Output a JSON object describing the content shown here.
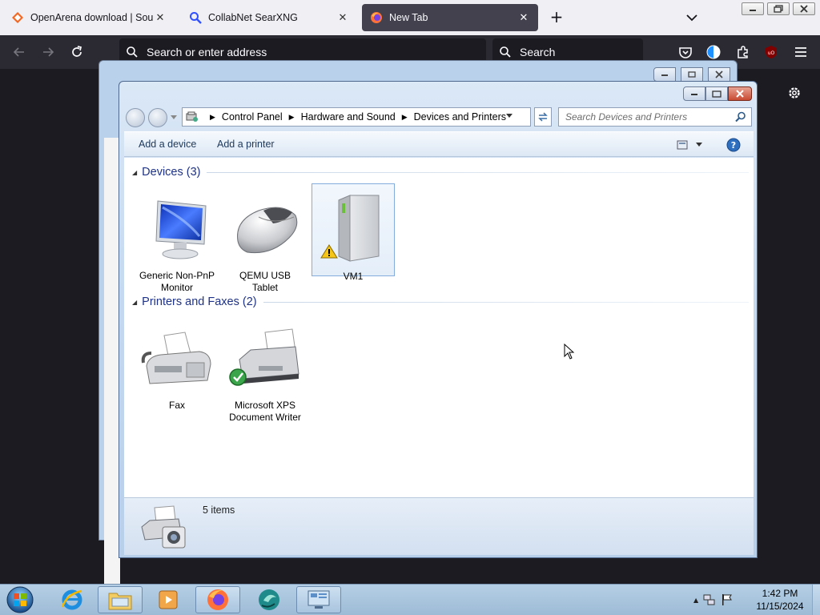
{
  "firefox": {
    "tabs": [
      {
        "title": "OpenArena download | SourceForge",
        "icon": "sourceforge-icon",
        "active": false
      },
      {
        "title": "CollabNet SearXNG",
        "icon": "search-icon",
        "active": false
      },
      {
        "title": "New Tab",
        "icon": "firefox-icon",
        "active": true
      }
    ],
    "url_placeholder": "Search or enter address",
    "search_placeholder": "Search"
  },
  "explorer": {
    "breadcrumb": [
      "Control Panel",
      "Hardware and Sound",
      "Devices and Printers"
    ],
    "search_placeholder": "Search Devices and Printers",
    "commands": {
      "add_device": "Add a device",
      "add_printer": "Add a printer"
    },
    "groups": [
      {
        "title": "Devices (3)",
        "items": [
          {
            "label_line1": "Generic Non-PnP",
            "label_line2": "Monitor",
            "icon": "monitor-icon",
            "selected": false
          },
          {
            "label_line1": "QEMU USB",
            "label_line2": "Tablet",
            "icon": "mouse-icon",
            "selected": false
          },
          {
            "label_line1": "VM1",
            "label_line2": "",
            "icon": "computer-tower-icon",
            "selected": true,
            "warning": true
          }
        ]
      },
      {
        "title": "Printers and Faxes (2)",
        "items": [
          {
            "label_line1": "Fax",
            "label_line2": "",
            "icon": "fax-icon",
            "selected": false
          },
          {
            "label_line1": "Microsoft XPS",
            "label_line2": "Document Writer",
            "icon": "printer-icon",
            "selected": false,
            "default": true
          }
        ]
      }
    ],
    "status_count": "5 items"
  },
  "taskbar": {
    "time": "1:42 PM",
    "date": "11/15/2024"
  }
}
